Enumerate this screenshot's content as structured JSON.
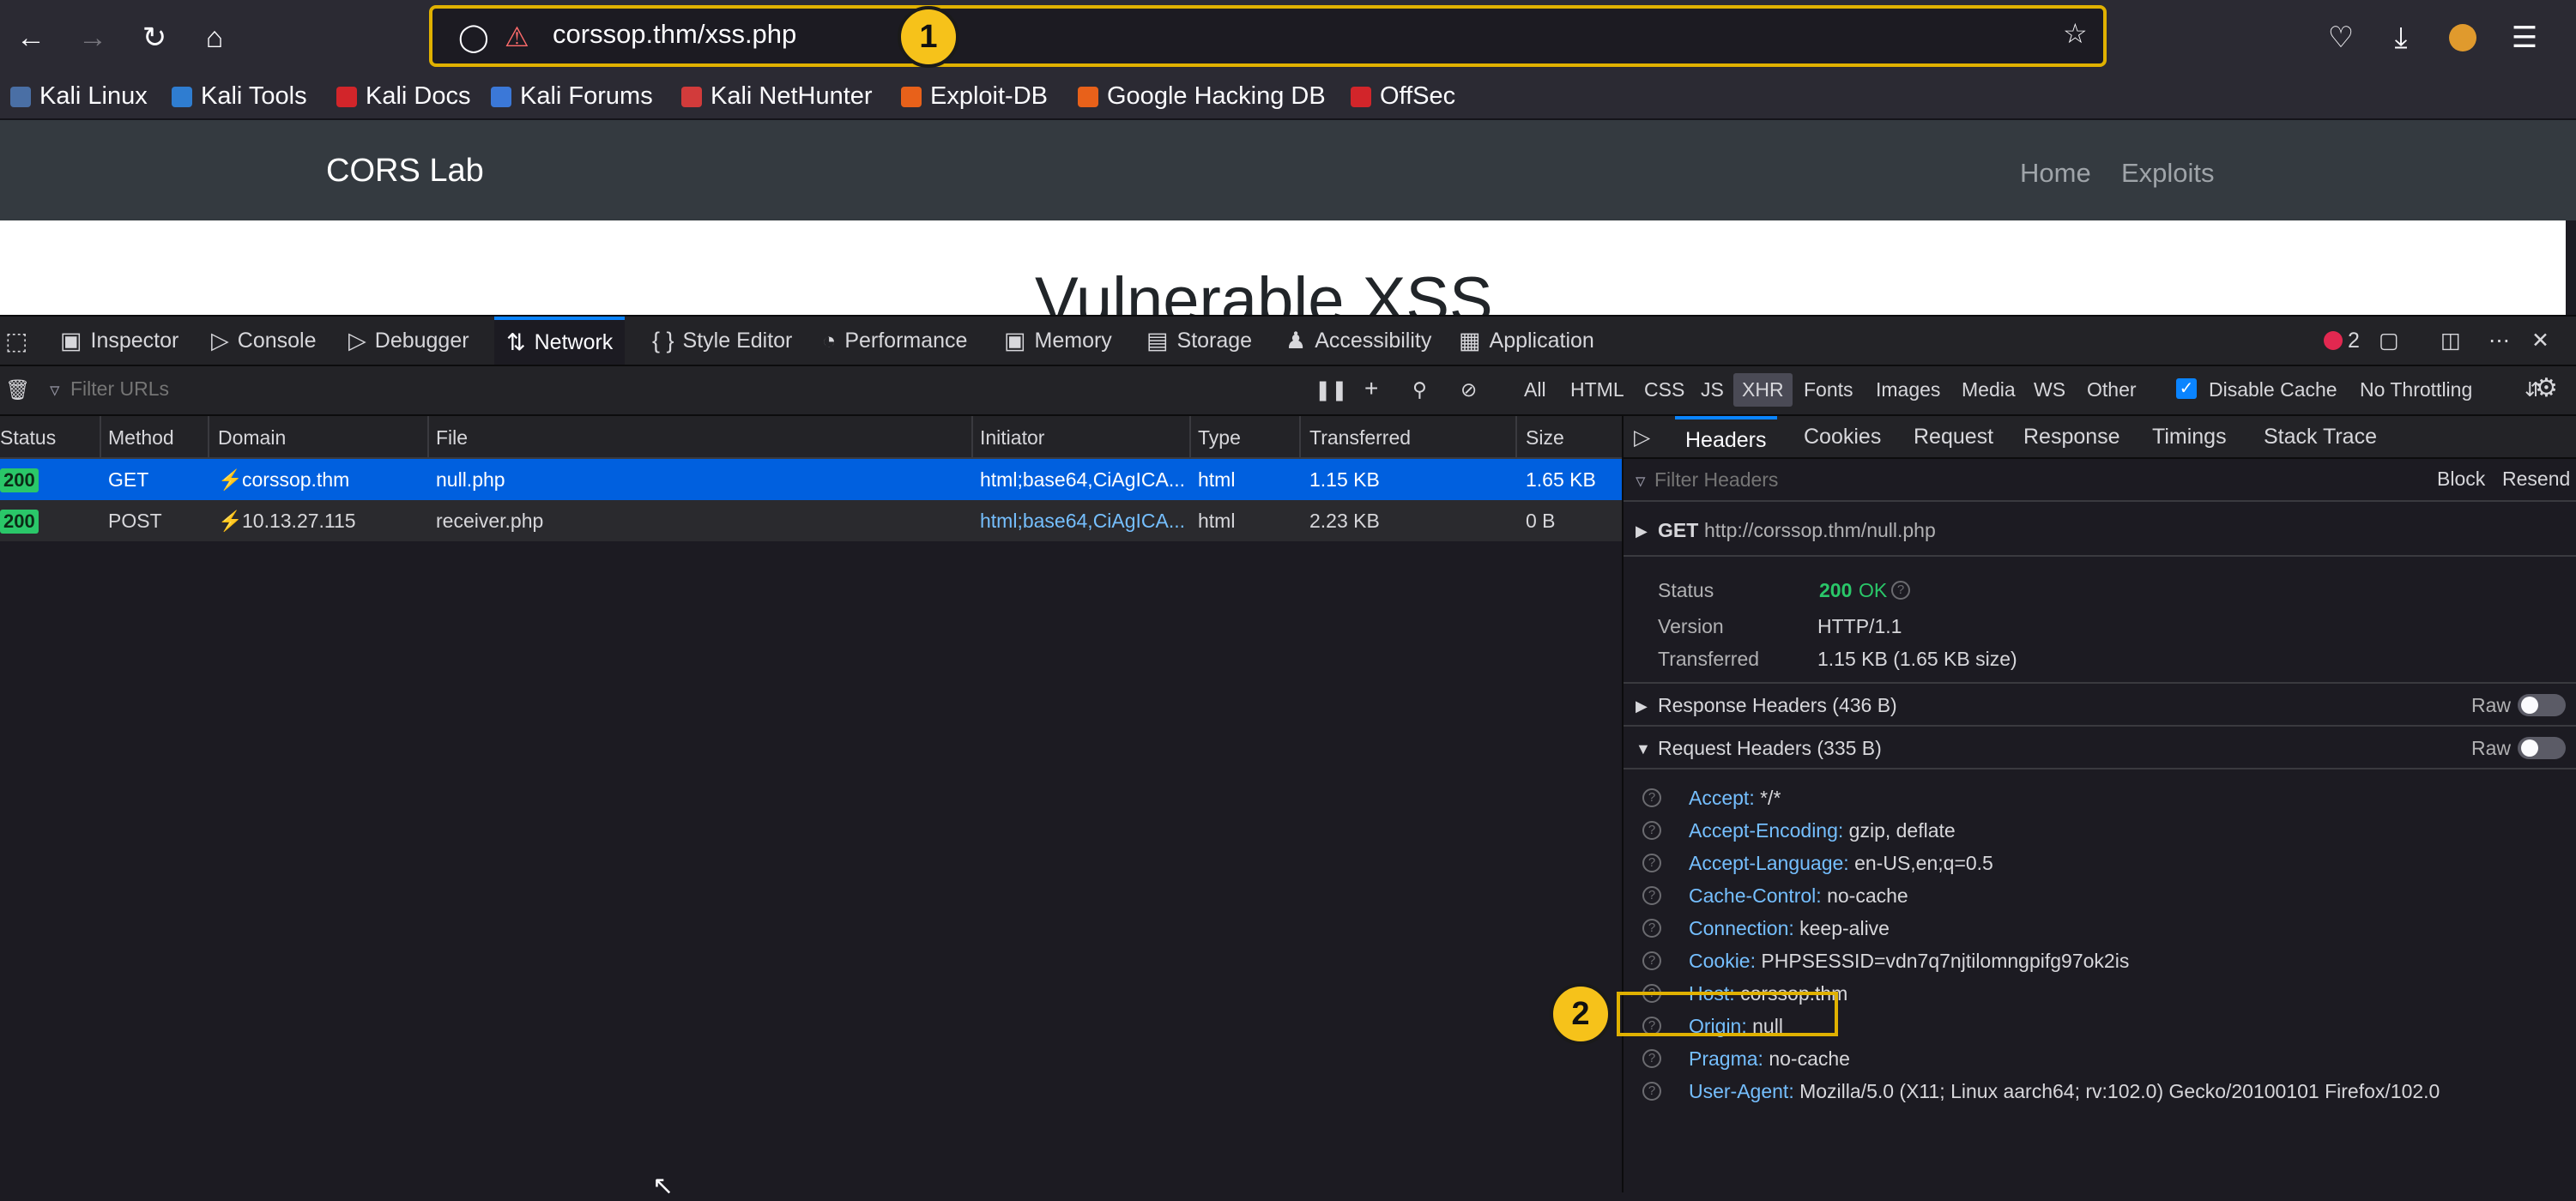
{
  "browser": {
    "url": "corssop.thm/xss.php",
    "bookmarks": [
      "Kali Linux",
      "Kali Tools",
      "Kali Docs",
      "Kali Forums",
      "Kali NetHunter",
      "Exploit-DB",
      "Google Hacking DB",
      "OffSec"
    ]
  },
  "annotations": {
    "badge1": "1",
    "badge2": "2"
  },
  "page": {
    "site_title": "CORS Lab",
    "nav": [
      "Home",
      "Exploits"
    ],
    "heading": "Vulnerable XSS"
  },
  "devtools": {
    "tabs": [
      "Inspector",
      "Console",
      "Debugger",
      "Network",
      "Style Editor",
      "Performance",
      "Memory",
      "Storage",
      "Accessibility",
      "Application"
    ],
    "error_count": "2",
    "filter_placeholder": "Filter URLs",
    "type_filters": [
      "All",
      "HTML",
      "CSS",
      "JS",
      "XHR",
      "Fonts",
      "Images",
      "Media",
      "WS",
      "Other"
    ],
    "disable_cache": "Disable Cache",
    "throttling": "No Throttling",
    "columns": [
      "Status",
      "Method",
      "Domain",
      "File",
      "Initiator",
      "Type",
      "Transferred",
      "Size"
    ],
    "requests": [
      {
        "status": "200",
        "method": "GET",
        "domain": "corssop.thm",
        "file": "null.php",
        "initiator": "html;base64,CiAgICA...",
        "type": "html",
        "transferred": "1.15 KB",
        "size": "1.65 KB"
      },
      {
        "status": "200",
        "method": "POST",
        "domain": "10.13.27.115",
        "file": "receiver.php",
        "initiator": "html;base64,CiAgICA...",
        "type": "html",
        "transferred": "2.23 KB",
        "size": "0 B"
      }
    ],
    "sidebar": {
      "tabs": [
        "Headers",
        "Cookies",
        "Request",
        "Response",
        "Timings",
        "Stack Trace"
      ],
      "filter_placeholder": "Filter Headers",
      "block": "Block",
      "resend": "Resend",
      "request_line": {
        "method": "GET",
        "url": "http://corssop.thm/null.php"
      },
      "summary": {
        "status_label": "Status",
        "status_code": "200",
        "status_text": "OK",
        "version_label": "Version",
        "version": "HTTP/1.1",
        "transferred_label": "Transferred",
        "transferred": "1.15 KB (1.65 KB size)"
      },
      "response_headers": "Response Headers (436 B)",
      "request_headers": "Request Headers (335 B)",
      "raw": "Raw",
      "headers": [
        {
          "name": "Accept:",
          "value": "*/*"
        },
        {
          "name": "Accept-Encoding:",
          "value": "gzip, deflate"
        },
        {
          "name": "Accept-Language:",
          "value": "en-US,en;q=0.5"
        },
        {
          "name": "Cache-Control:",
          "value": "no-cache"
        },
        {
          "name": "Connection:",
          "value": "keep-alive"
        },
        {
          "name": "Cookie:",
          "value": "PHPSESSID=vdn7q7njtilomngpifg97ok2is"
        },
        {
          "name": "Host:",
          "value": "corssop.thm"
        },
        {
          "name": "Origin:",
          "value": "null"
        },
        {
          "name": "Pragma:",
          "value": "no-cache"
        },
        {
          "name": "User-Agent:",
          "value": "Mozilla/5.0 (X11; Linux aarch64; rv:102.0) Gecko/20100101 Firefox/102.0"
        }
      ]
    }
  }
}
